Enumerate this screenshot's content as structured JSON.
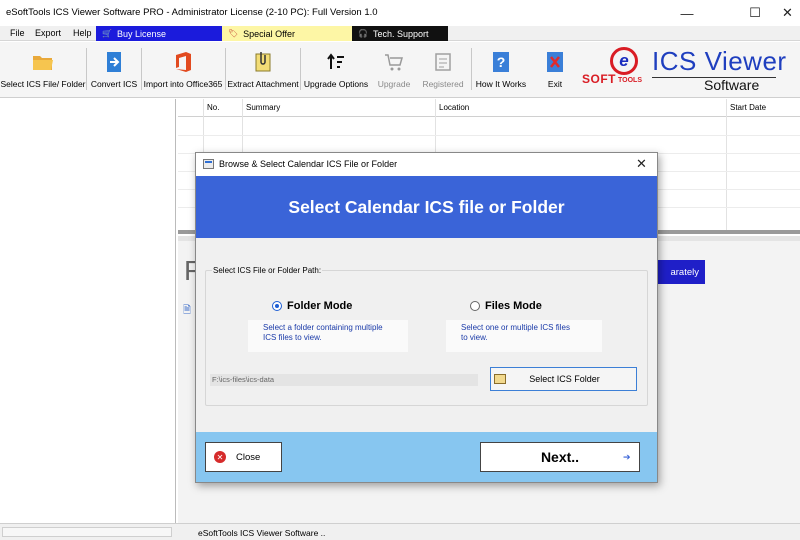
{
  "window": {
    "title": "eSoftTools ICS Viewer Software PRO - Administrator License (2-10 PC): Full Version 1.0",
    "min_glyph": "—",
    "max_glyph": "☐",
    "close_glyph": "✕"
  },
  "menu": {
    "items": [
      "File",
      "Export",
      "Help"
    ],
    "buy_license": "Buy License",
    "special_offer": "Special Offer",
    "tech_support": "Tech. Support"
  },
  "toolbar": {
    "buttons": [
      {
        "label": "Select ICS File/ Folder",
        "icon": "folder-open-icon",
        "enabled": true
      },
      {
        "label": "Convert ICS",
        "icon": "convert-icon",
        "enabled": true
      },
      {
        "label": "Import into Office365",
        "icon": "office365-icon",
        "enabled": true
      },
      {
        "label": "Extract Attachment",
        "icon": "attachment-icon",
        "enabled": true
      },
      {
        "label": "Upgrade Options",
        "icon": "upgrade-options-icon",
        "enabled": true
      },
      {
        "label": "Upgrade",
        "icon": "cart-icon",
        "enabled": false
      },
      {
        "label": "Registered",
        "icon": "registered-icon",
        "enabled": false
      },
      {
        "label": "How It Works",
        "icon": "help-icon",
        "enabled": true
      },
      {
        "label": "Exit",
        "icon": "exit-icon",
        "enabled": true
      }
    ]
  },
  "logo": {
    "e_letter": "e",
    "soft": "SOFT",
    "tools": "TOOLS",
    "brand": "ICS Viewer",
    "sub": "Software"
  },
  "grid": {
    "columns": [
      "No.",
      "Summary",
      "Location",
      "Start Date"
    ]
  },
  "bottom_pane": {
    "big_letter": "F",
    "separately_fragment": "arately"
  },
  "statusbar": {
    "text": "eSoftTools ICS Viewer Software .."
  },
  "dialog": {
    "title": "Browse & Select Calendar ICS File or Folder",
    "close_glyph": "✕",
    "banner": "Select Calendar ICS file or Folder",
    "group_legend": "Select ICS File or Folder Path:",
    "folder_mode": {
      "label": "Folder Mode",
      "selected": true,
      "desc_line1": "Select a folder containing multiple",
      "desc_line2": "ICS files to view."
    },
    "files_mode": {
      "label": "Files Mode",
      "selected": false,
      "desc_line1": "Select one or multiple ICS files",
      "desc_line2": "to view."
    },
    "path_value": "F:\\ics-files\\ics-data",
    "select_folder_button": "Select ICS Folder",
    "close_button": "Close",
    "next_button": "Next.."
  },
  "colors": {
    "banner_blue": "#3a64d8",
    "footer_blue": "#87c6f0",
    "buy_license_bg": "#1b1bdc",
    "special_offer_bg": "#fdf6a5",
    "tech_support_bg": "#111111",
    "logo_red": "#d91c24",
    "logo_blue": "#1f3fbf"
  }
}
